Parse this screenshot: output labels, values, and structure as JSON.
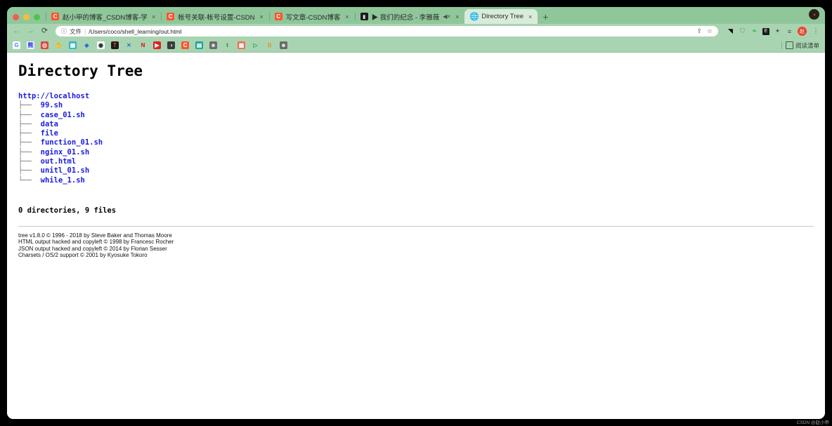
{
  "window": {
    "traffic_lights": [
      "close",
      "minimize",
      "zoom"
    ],
    "close_button": "window-close"
  },
  "tabs": [
    {
      "favicon": "csdn-icon",
      "title": "赵小甲的博客_CSDN博客-学习记",
      "close": "×",
      "active": false,
      "muted": false
    },
    {
      "favicon": "csdn-icon",
      "title": "帐号关联-帐号设置-CSDN",
      "close": "×",
      "active": false,
      "muted": false
    },
    {
      "favicon": "csdn-icon",
      "title": "写文章-CSDN博客",
      "close": "×",
      "active": false,
      "muted": false
    },
    {
      "favicon": "video-icon",
      "title": "▶ 我们的纪念 - 李雅薇",
      "close": "×",
      "active": false,
      "muted": true,
      "mute_glyph": "◀×"
    },
    {
      "favicon": "globe-icon",
      "title": "Directory Tree",
      "close": "×",
      "active": true,
      "muted": false
    }
  ],
  "newtab_label": "+",
  "toolbar": {
    "back": "←",
    "forward": "→",
    "reload": "⟳",
    "omnibox": {
      "info_icon": "ⓘ",
      "scheme_label": "文件",
      "separator": "|",
      "url": "/Users/coco/shell_learning/out.html",
      "share_icon": "share-icon",
      "bookmark_icon": "☆"
    },
    "extensions": [
      {
        "name": "extension-icon-1",
        "glyph": "◥"
      },
      {
        "name": "shield-icon",
        "glyph": "⛉"
      },
      {
        "name": "evernote-icon",
        "glyph": "❧"
      },
      {
        "name": "extension-icon-dark",
        "glyph": "E"
      },
      {
        "name": "puzzle-icon",
        "glyph": "✦"
      },
      {
        "name": "list-icon",
        "glyph": "≡"
      }
    ],
    "profile_initial": "赵",
    "menu_glyph": "⋮"
  },
  "bookmarks": {
    "items": [
      {
        "name": "google-bookmark",
        "label": "G",
        "bg": "#ffffff",
        "fg": "#4285f4"
      },
      {
        "name": "baidu-bookmark",
        "label": "熊",
        "bg": "#e8f0fb",
        "fg": "#2932e1"
      },
      {
        "name": "redcircle-bookmark",
        "label": "◎",
        "bg": "#d94a3a",
        "fg": "#ffffff"
      },
      {
        "name": "hand-bookmark",
        "label": "✋",
        "bg": "#a9d4b1",
        "fg": "#d9a066"
      },
      {
        "name": "calendar-bookmark",
        "label": "▦",
        "bg": "#2fb7c9",
        "fg": "#ffffff"
      },
      {
        "name": "diamond-bookmark",
        "label": "◆",
        "bg": "#a9d4b1",
        "fg": "#2f6fd0"
      },
      {
        "name": "github-bookmark",
        "label": "◉",
        "bg": "#ffffff",
        "fg": "#24292e"
      },
      {
        "name": "t-bookmark",
        "label": "T",
        "bg": "#1b1b1b",
        "fg": "#ff3b30"
      },
      {
        "name": "x-bookmark",
        "label": "✕",
        "bg": "#a9d4b1",
        "fg": "#2b6fd6"
      },
      {
        "name": "netflix-bookmark",
        "label": "N",
        "bg": "#a9d4b1",
        "fg": "#e50914"
      },
      {
        "name": "youtube-bookmark",
        "label": "▶",
        "bg": "#e02020",
        "fg": "#ffffff"
      },
      {
        "name": "dark-bookmark",
        "label": "◑",
        "bg": "#3b3b3b",
        "fg": "#dddddd"
      },
      {
        "name": "csdn-bookmark",
        "label": "C",
        "bg": "#fc5531",
        "fg": "#ffffff"
      },
      {
        "name": "teal-bookmark",
        "label": "▤",
        "bg": "#17a398",
        "fg": "#ffffff"
      },
      {
        "name": "avatar-bookmark",
        "label": "☻",
        "bg": "#6b6b6b",
        "fg": "#e8e8e8"
      },
      {
        "name": "tumblr-bookmark",
        "label": "t",
        "bg": "#a9d4b1",
        "fg": "#2f7d3f"
      },
      {
        "name": "colorful-bookmark",
        "label": "▦",
        "bg": "#f26c4f",
        "fg": "#ffffff"
      },
      {
        "name": "play-bookmark",
        "label": "▷",
        "bg": "#a9d4b1",
        "fg": "#2faa4a"
      },
      {
        "name": "bracket-bookmark",
        "label": "⦗⦘",
        "bg": "#a9d4b1",
        "fg": "#e08b2f"
      },
      {
        "name": "avatar2-bookmark",
        "label": "☻",
        "bg": "#6b6b6b",
        "fg": "#e8e8e8"
      }
    ],
    "reading_list_label": "阅读清单"
  },
  "content": {
    "title": "Directory Tree",
    "root": "http://localhost",
    "entries": [
      {
        "branch": "├──",
        "name": "99.sh"
      },
      {
        "branch": "├──",
        "name": "case_01.sh"
      },
      {
        "branch": "├──",
        "name": "data"
      },
      {
        "branch": "├──",
        "name": "file"
      },
      {
        "branch": "├──",
        "name": "function_01.sh"
      },
      {
        "branch": "├──",
        "name": "nginx_01.sh"
      },
      {
        "branch": "├──",
        "name": "out.html"
      },
      {
        "branch": "├──",
        "name": "unitl_01.sh"
      },
      {
        "branch": "└──",
        "name": "while_1.sh"
      }
    ],
    "summary": "0 directories, 9 files",
    "credits": [
      "tree v1.8.0 © 1996 - 2018 by Steve Baker and Thomas Moore",
      "HTML output hacked and copyleft © 1998 by Francesc Rocher",
      "JSON output hacked and copyleft © 2014 by Florian Sesser",
      "Charsets / OS/2 support © 2001 by Kyosuke Tokoro"
    ]
  },
  "watermark": "CSDN @赵小甲",
  "colors": {
    "chrome_tabstrip": "#8fc79a",
    "chrome_toolbar": "#a9d4b1",
    "active_tab": "#d9ecdb",
    "link_blue": "#1a1ae0",
    "page_bg": "#ffffff"
  }
}
